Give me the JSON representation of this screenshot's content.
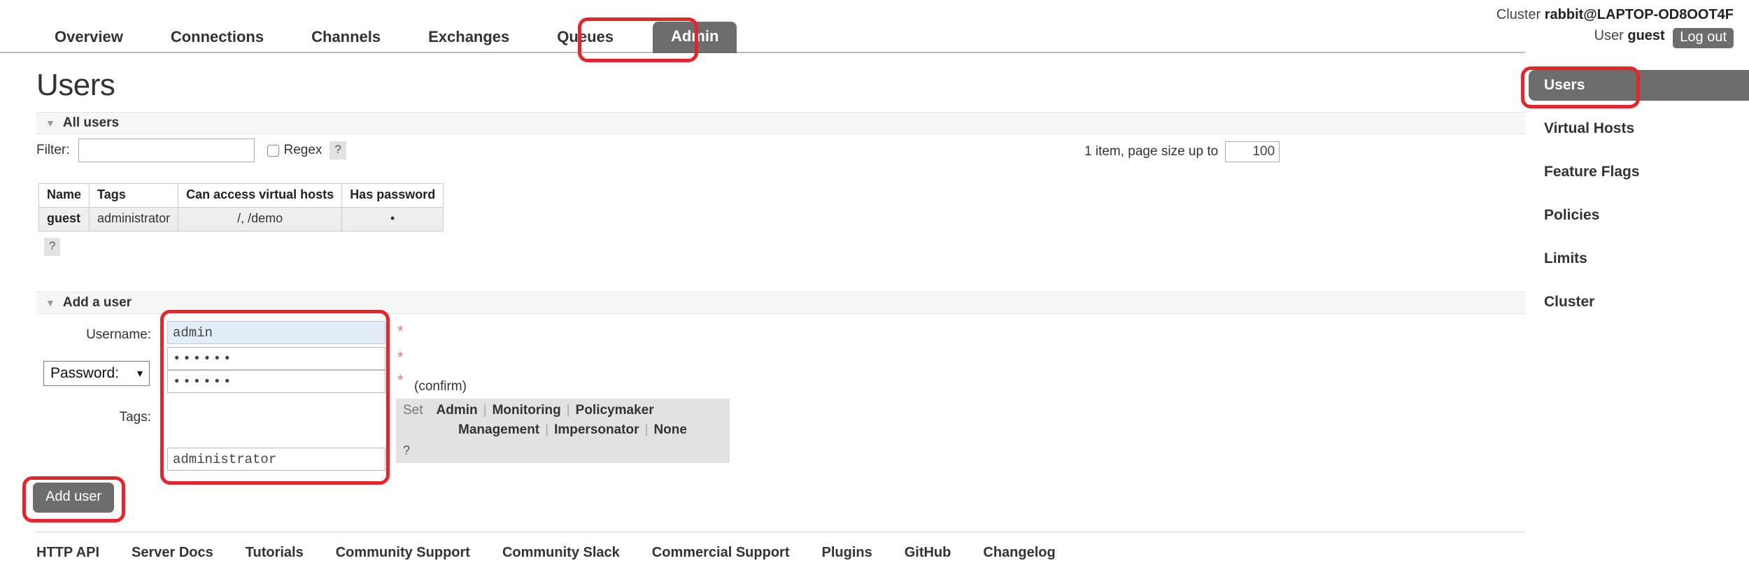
{
  "header": {
    "cluster_label": "Cluster",
    "cluster_name": "rabbit@LAPTOP-OD8OOT4F",
    "user_label": "User",
    "user_name": "guest",
    "logout_label": "Log out"
  },
  "nav": {
    "tabs": [
      {
        "label": "Overview",
        "active": false
      },
      {
        "label": "Connections",
        "active": false
      },
      {
        "label": "Channels",
        "active": false
      },
      {
        "label": "Exchanges",
        "active": false
      },
      {
        "label": "Queues",
        "active": false
      },
      {
        "label": "Admin",
        "active": true
      }
    ]
  },
  "page": {
    "title": "Users"
  },
  "all_users": {
    "section_label": "All users",
    "caret": "▼",
    "filter_label": "Filter:",
    "filter_value": "",
    "filter_placeholder": "",
    "regex_label": "Regex",
    "regex_checked": false,
    "help_mark": "?",
    "pagesize_label": "1 item, page size up to",
    "pagesize_value": "100",
    "table": {
      "columns": [
        "Name",
        "Tags",
        "Can access virtual hosts",
        "Has password"
      ],
      "rows": [
        {
          "name": "guest",
          "tags": "administrator",
          "vhosts": "/, /demo",
          "has_password": "•"
        }
      ]
    },
    "table_help_mark": "?"
  },
  "add_user": {
    "section_label": "Add a user",
    "caret": "▼",
    "username_label": "Username:",
    "username_value": "admin",
    "password_select_label": "Password:",
    "password_select_chevron": "⌄",
    "password_value": "••••••",
    "password_confirm_value": "••••••",
    "confirm_text": "(confirm)",
    "required_star": "*",
    "tags_label": "Tags:",
    "tags_value": "administrator",
    "set_label": "Set",
    "tag_links_row1": [
      "Admin",
      "Monitoring",
      "Policymaker"
    ],
    "tag_links_row2": [
      "Management",
      "Impersonator",
      "None"
    ],
    "tag_separator": "|",
    "tags_help_mark": "?",
    "submit_label": "Add user"
  },
  "sidebar": {
    "items": [
      {
        "label": "Users",
        "active": true
      },
      {
        "label": "Virtual Hosts",
        "active": false
      },
      {
        "label": "Feature Flags",
        "active": false
      },
      {
        "label": "Policies",
        "active": false
      },
      {
        "label": "Limits",
        "active": false
      },
      {
        "label": "Cluster",
        "active": false
      }
    ]
  },
  "footer": {
    "links": [
      "HTTP API",
      "Server Docs",
      "Tutorials",
      "Community Support",
      "Community Slack",
      "Commercial Support",
      "Plugins",
      "GitHub",
      "Changelog"
    ]
  },
  "annotations": {
    "highlight_color": "#e8242a",
    "boxes": [
      "admin-tab",
      "sidebar-users",
      "add-user-fields",
      "add-user-button"
    ]
  }
}
